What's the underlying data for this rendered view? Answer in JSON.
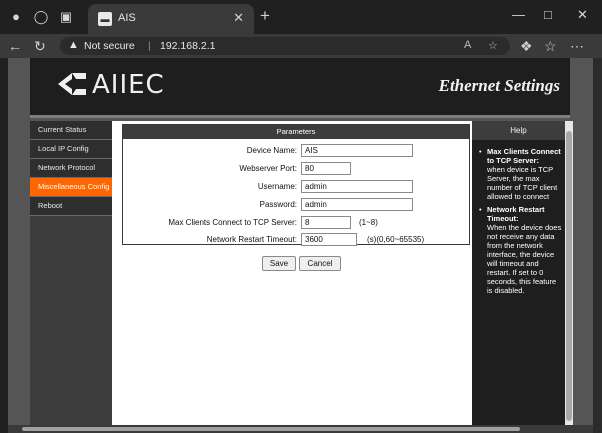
{
  "browser": {
    "tab_title": "AIS",
    "tab_favicon": "AIS",
    "not_secure": "Not secure",
    "url": "192.168.2.1",
    "icons": [
      "profile-icon",
      "workspaces-icon",
      "tab-actions-icon",
      "back-icon",
      "refresh-icon",
      "warning-icon",
      "read-aloud-icon",
      "favorite-icon",
      "copilot-icon",
      "collections-icon",
      "more-icon"
    ]
  },
  "page": {
    "logo_text": "AIIEC",
    "title": "Ethernet Settings"
  },
  "sidebar": {
    "items": [
      {
        "label": "Current Status"
      },
      {
        "label": "Local IP Config"
      },
      {
        "label": "Network Protocol"
      },
      {
        "label": "Miscellaneous Config",
        "active": true
      },
      {
        "label": "Reboot"
      }
    ]
  },
  "params": {
    "header": "Parameters",
    "device_name_label": "Device Name:",
    "device_name_value": "AIS",
    "webserver_port_label": "Webserver Port:",
    "webserver_port_value": "80",
    "username_label": "Username:",
    "username_value": "admin",
    "password_label": "Password:",
    "password_value": "admin",
    "max_clients_label": "Max Clients Connect to TCP Server:",
    "max_clients_value": "8",
    "max_clients_hint": "(1~8)",
    "restart_timeout_label": "Network Restart Timeout:",
    "restart_timeout_value": "3600",
    "restart_timeout_hint": "(s)(0,60~65535)"
  },
  "buttons": {
    "save": "Save",
    "cancel": "Cancel"
  },
  "help": {
    "header": "Help",
    "item1_title": "Max Clients Connect to TCP Server:",
    "item1_text": "when device is TCP Server, the max number of TCP client allowed to connect",
    "item2_title": "Network Restart Timeout:",
    "item2_text": "When the device does not receive any data from the network interface, the device will timeout and restart. If set to 0 seconds, this feature is disabled."
  },
  "colors": {
    "accent": "#ff6600",
    "dark": "#1e1e1e"
  }
}
